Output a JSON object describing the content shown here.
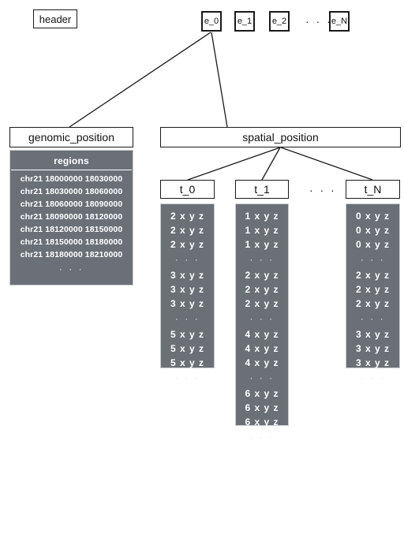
{
  "diagram": {
    "header": {
      "label": "header"
    },
    "entries": {
      "boxes": [
        {
          "label": "e_0"
        },
        {
          "label": "e_1"
        },
        {
          "label": "e_2"
        },
        {
          "label": "e_N"
        }
      ],
      "ellipsis": "· · ·"
    },
    "genomic_position": {
      "label": "genomic_position",
      "table_title": "regions",
      "rows": [
        "chr21  18000000 18030000",
        "chr21  18030000 18060000",
        "chr21  18060000 18090000",
        "chr21  18090000 18120000",
        "chr21  18120000 18150000",
        "chr21  18150000 18180000",
        "chr21  18180000 18210000"
      ],
      "ellipsis": "· · ·"
    },
    "spatial_position": {
      "label": "spatial_position",
      "ellipsis": "· · ·",
      "timepoints": [
        {
          "label": "t_0",
          "groups": [
            {
              "rows": [
                "2 x y z",
                "2 x y z",
                "2 x y z"
              ],
              "ellipsis": "· · ·"
            },
            {
              "rows": [
                "3 x y z",
                "3 x y z",
                "3 x y z"
              ],
              "ellipsis": "· · ·"
            },
            {
              "rows": [
                "5 x y z",
                "5 x y z",
                "5 x y z"
              ],
              "ellipsis": "· · ·"
            }
          ]
        },
        {
          "label": "t_1",
          "groups": [
            {
              "rows": [
                "1 x y z",
                "1 x y z",
                "1 x y z"
              ],
              "ellipsis": "· · ·"
            },
            {
              "rows": [
                "2 x y z",
                "2 x y z",
                "2 x y z"
              ],
              "ellipsis": "· · ·"
            },
            {
              "rows": [
                "4 x y z",
                "4 x y z",
                "4 x y z"
              ],
              "ellipsis": "· · ·"
            },
            {
              "rows": [
                "6 x y z",
                "6 x y z",
                "6 x y z"
              ],
              "ellipsis": "· · ·"
            }
          ]
        },
        {
          "label": "t_N",
          "groups": [
            {
              "rows": [
                "0 x y z",
                "0 x y z",
                "0 x y z"
              ],
              "ellipsis": "· · ·"
            },
            {
              "rows": [
                "2 x y z",
                "2 x y z",
                "2 x y z"
              ],
              "ellipsis": "· · ·"
            },
            {
              "rows": [
                "3 x y z",
                "3 x y z",
                "3 x y z"
              ],
              "ellipsis": "· · ·"
            }
          ]
        }
      ]
    },
    "colors": {
      "panel_fill": "#6b7077",
      "panel_text": "#ffffff",
      "stroke": "#1a1a1a",
      "background": "#ffffff"
    }
  }
}
